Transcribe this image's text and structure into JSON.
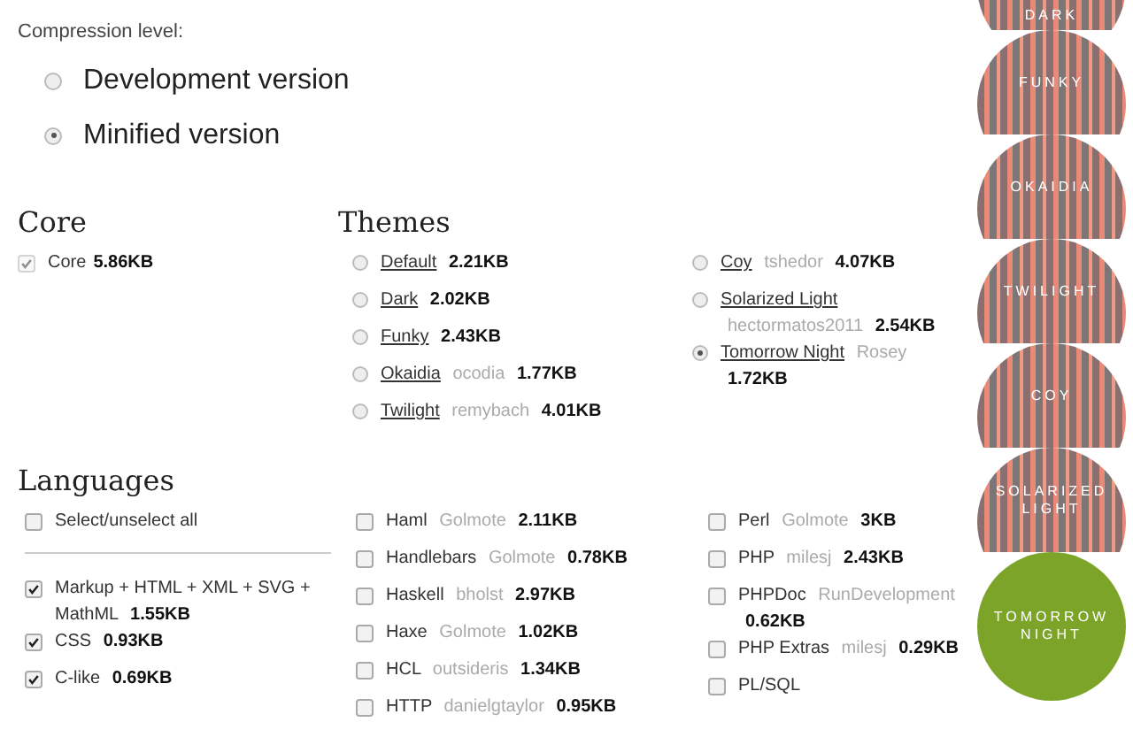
{
  "compression": {
    "label": "Compression level:",
    "options": [
      {
        "label": "Development version",
        "selected": false
      },
      {
        "label": "Minified version",
        "selected": true
      }
    ]
  },
  "core": {
    "heading": "Core",
    "items": [
      {
        "label": "Core",
        "size": "5.86KB",
        "checked": true,
        "disabled": true
      }
    ]
  },
  "themes": {
    "heading": "Themes",
    "columns": [
      [
        {
          "name": "Default",
          "size": "2.21KB",
          "selected": false
        },
        {
          "name": "Dark",
          "size": "2.02KB",
          "selected": false
        },
        {
          "name": "Funky",
          "size": "2.43KB",
          "selected": false
        },
        {
          "name": "Okaidia",
          "author": "ocodia",
          "size": "1.77KB",
          "selected": false
        },
        {
          "name": "Twilight",
          "author": "remybach",
          "size": "4.01KB",
          "selected": false
        }
      ],
      [
        {
          "name": "Coy",
          "author": "tshedor",
          "size": "4.07KB",
          "selected": false
        },
        {
          "name": "Solarized Light",
          "author": "hectormatos2011",
          "size": "2.54KB",
          "selected": false
        },
        {
          "name": "Tomorrow Night",
          "author": "Rosey",
          "size": "1.72KB",
          "selected": true
        }
      ]
    ]
  },
  "languages": {
    "heading": "Languages",
    "select_all": {
      "label": "Select/unselect all",
      "checked": false
    },
    "columns": [
      [
        {
          "name": "Markup + HTML + XML + SVG + MathML",
          "size": "1.55KB",
          "checked": true
        },
        {
          "name": "CSS",
          "size": "0.93KB",
          "checked": true
        },
        {
          "name": "C-like",
          "size": "0.69KB",
          "checked": true
        }
      ],
      [
        {
          "name": "Haml",
          "author": "Golmote",
          "size": "2.11KB",
          "checked": false
        },
        {
          "name": "Handlebars",
          "author": "Golmote",
          "size": "0.78KB",
          "checked": false
        },
        {
          "name": "Haskell",
          "author": "bholst",
          "size": "2.97KB",
          "checked": false
        },
        {
          "name": "Haxe",
          "author": "Golmote",
          "size": "1.02KB",
          "checked": false
        },
        {
          "name": "HCL",
          "author": "outsideris",
          "size": "1.34KB",
          "checked": false
        },
        {
          "name": "HTTP",
          "author": "danielgtaylor",
          "size": "0.95KB",
          "checked": false
        }
      ],
      [
        {
          "name": "Perl",
          "author": "Golmote",
          "size": "3KB",
          "checked": false
        },
        {
          "name": "PHP",
          "author": "milesj",
          "size": "2.43KB",
          "checked": false
        },
        {
          "name": "PHPDoc",
          "author": "RunDevelopment",
          "size": "0.62KB",
          "checked": false
        },
        {
          "name": "PHP Extras",
          "author": "milesj",
          "size": "0.29KB",
          "checked": false
        },
        {
          "name": "PL/SQL",
          "checked": false
        }
      ]
    ]
  },
  "theme_previews": [
    {
      "label": "DARK",
      "selected": false
    },
    {
      "label": "FUNKY",
      "selected": false
    },
    {
      "label": "OKAIDIA",
      "selected": false
    },
    {
      "label": "TWILIGHT",
      "selected": false
    },
    {
      "label": "COY",
      "selected": false
    },
    {
      "label": "SOLARIZED LIGHT",
      "selected": false
    },
    {
      "label": "TOMORROW NIGHT",
      "selected": true
    }
  ]
}
